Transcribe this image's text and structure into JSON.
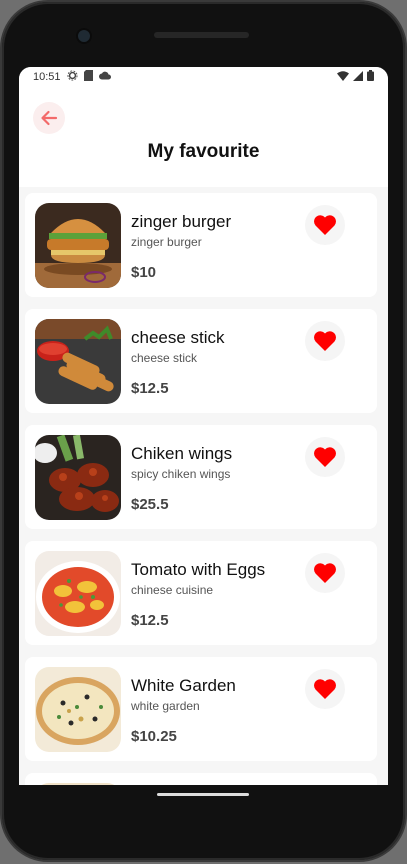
{
  "status_bar": {
    "time": "10:51"
  },
  "header": {
    "title": "My favourite",
    "back_icon": "arrow-left-icon"
  },
  "accent_color": "#ff0000",
  "favourites": [
    {
      "name": "zinger burger",
      "description": "zinger burger",
      "price": "$10",
      "image": "burger"
    },
    {
      "name": "cheese stick",
      "description": "cheese stick",
      "price": "$12.5",
      "image": "cheese-sticks"
    },
    {
      "name": "Chiken wings",
      "description": "spicy chiken wings",
      "price": "$25.5",
      "image": "chicken-wings"
    },
    {
      "name": "Tomato with Eggs",
      "description": "chinese cuisine",
      "price": "$12.5",
      "image": "tomato-eggs"
    },
    {
      "name": "White Garden",
      "description": "white garden",
      "price": "$10.25",
      "image": "pizza"
    }
  ]
}
